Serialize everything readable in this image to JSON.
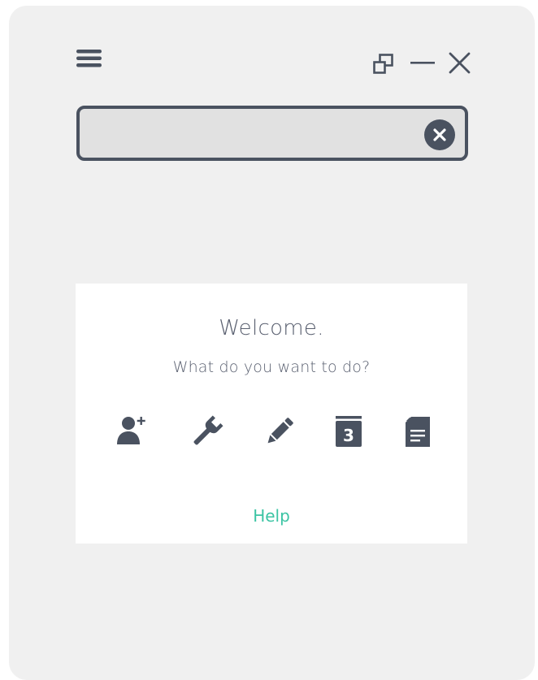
{
  "window": {
    "controls": {
      "menu_icon": "hamburger-menu-icon",
      "restore_icon": "restore-window-icon",
      "minimize_icon": "minimize-icon",
      "close_icon": "close-icon"
    }
  },
  "search": {
    "value": "",
    "placeholder": "",
    "clear_icon": "clear-icon"
  },
  "welcome": {
    "title": "Welcome.",
    "subtitle": "What do you want to do?",
    "actions": [
      {
        "icon": "add-user-icon"
      },
      {
        "icon": "wrench-icon"
      },
      {
        "icon": "pencil-icon"
      },
      {
        "icon": "calendar-icon",
        "day": "3"
      },
      {
        "icon": "document-icon"
      }
    ],
    "help_label": "Help"
  },
  "colors": {
    "background": "#f0f0f0",
    "icon": "#4a5260",
    "search_fill": "#e1e1e1",
    "card": "#ffffff",
    "text": "#5a6070",
    "link": "#3cc4a4"
  }
}
